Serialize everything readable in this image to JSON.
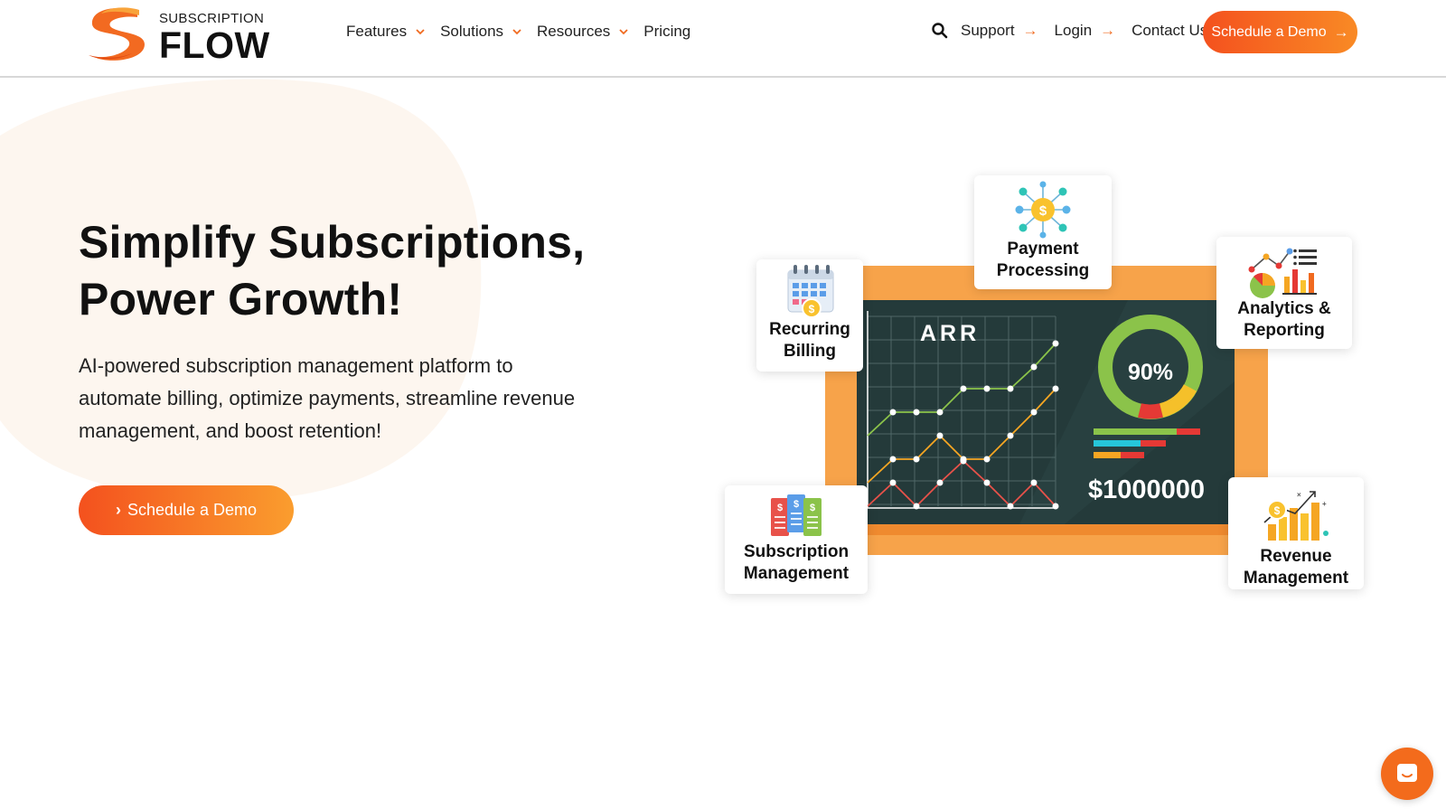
{
  "brand": {
    "logo_top": "SUBSCRIPTION",
    "logo_main": "FLOW",
    "accent": "#f4511e",
    "accent_light": "#f98a25"
  },
  "nav": {
    "items": [
      {
        "label": "Features",
        "has_dropdown": true
      },
      {
        "label": "Solutions",
        "has_dropdown": true
      },
      {
        "label": "Resources",
        "has_dropdown": true
      },
      {
        "label": "Pricing",
        "has_dropdown": false
      }
    ],
    "search_icon": "search-icon",
    "support_label": "Support",
    "login_label": "Login",
    "contact_label": "Contact Us",
    "cta_label": "Schedule a Demo"
  },
  "hero": {
    "headline_line1": "Simplify Subscriptions,",
    "headline_line2": "Power Growth!",
    "subtext_line1": "AI-powered subscription management platform to",
    "subtext_line2": "automate billing, optimize payments, streamline revenue",
    "subtext_line3": "management, and boost retention!",
    "cta_label": "Schedule a Demo"
  },
  "illustration": {
    "board_title": "ARR",
    "donut_percent": "90%",
    "revenue_value": "$1000000",
    "cards": {
      "payment": "Payment\nProcessing",
      "recurring": "Recurring\nBilling",
      "analytics": "Analytics &\nReporting",
      "subscription": "Subscription\nManagement",
      "revenue": "Revenue\nManagement"
    }
  },
  "chat": {
    "icon": "chat-icon"
  }
}
